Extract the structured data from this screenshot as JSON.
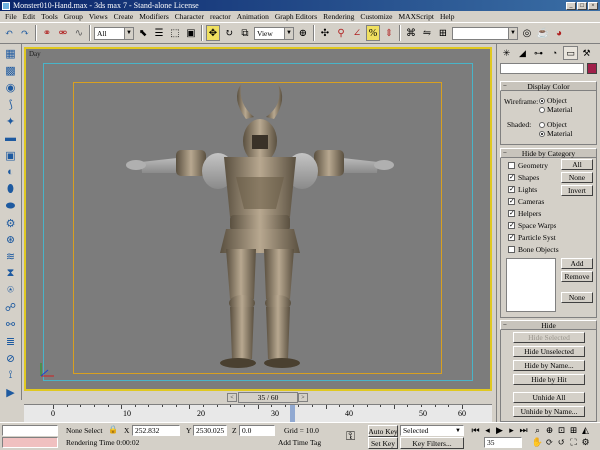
{
  "window": {
    "title": "Monster010-Hand.max - 3ds max 7 - Stand-alone License",
    "min": "_",
    "max": "□",
    "close": "×"
  },
  "menu": [
    "File",
    "Edit",
    "Tools",
    "Group",
    "Views",
    "Create",
    "Modifiers",
    "Character",
    "reactor",
    "Animation",
    "Graph Editors",
    "Rendering",
    "Customize",
    "MAXScript",
    "Help"
  ],
  "toolbar": {
    "selection_filter": "All",
    "reference_coord": "View"
  },
  "viewport": {
    "label": "Day",
    "frame_bg": "#7c7c7c",
    "active_border": "#e0c820"
  },
  "timeline": {
    "frame_display": "35 / 60",
    "prev": "<",
    "next": ">",
    "ruler_labels": [
      "0",
      "10",
      "20",
      "30",
      "40",
      "50",
      "60"
    ],
    "current_frame": 35,
    "total_frames": 60
  },
  "status": {
    "selection": "None Select",
    "prompt": "Rendering Time  0:00:02",
    "x_label": "X",
    "x_value": "252.832",
    "y_label": "Y",
    "y_value": "2530.025",
    "z_label": "Z",
    "z_value": "0.0",
    "grid": "Grid = 10.0",
    "add_time_tag": "Add Time Tag",
    "auto_key": "Auto Key",
    "set_key": "Set Key",
    "key_mode": "Selected",
    "key_filters": "Key Filters...",
    "frame_field": "35"
  },
  "panel": {
    "display_color": {
      "title": "Display Color",
      "wireframe_label": "Wireframe:",
      "shaded_label": "Shaded:",
      "object": "Object",
      "material": "Material"
    },
    "hide_by_category": {
      "title": "Hide by Category",
      "items": [
        {
          "label": "Geometry",
          "checked": false
        },
        {
          "label": "Shapes",
          "checked": true
        },
        {
          "label": "Lights",
          "checked": true
        },
        {
          "label": "Cameras",
          "checked": true
        },
        {
          "label": "Helpers",
          "checked": true
        },
        {
          "label": "Space Warps",
          "checked": true
        },
        {
          "label": "Particle Systems",
          "checked": true
        },
        {
          "label": "Bone Objects",
          "checked": false
        }
      ],
      "all": "All",
      "none": "None",
      "invert": "Invert",
      "add": "Add",
      "remove": "Remove",
      "none2": "None"
    },
    "hide": {
      "title": "Hide",
      "hide_selected": "Hide Selected",
      "hide_unselected": "Hide Unselected",
      "hide_by_name": "Hide by Name...",
      "hide_by_hit": "Hide by Hit",
      "unhide_all": "Unhide All",
      "unhide_by_name": "Unhide by Name..."
    }
  }
}
